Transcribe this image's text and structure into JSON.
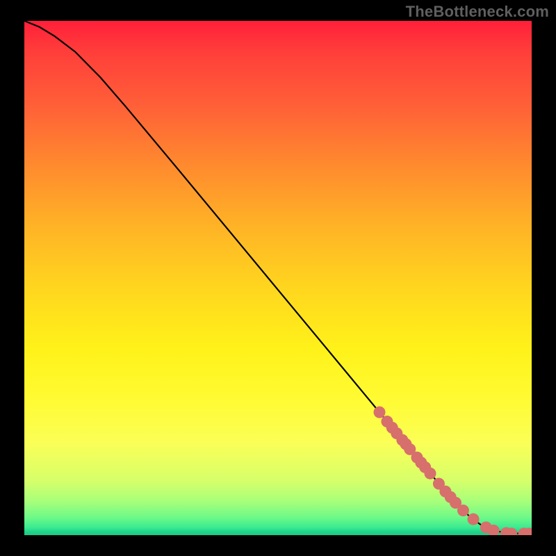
{
  "attribution": "TheBottleneck.com",
  "chart_data": {
    "type": "line",
    "title": "",
    "xlabel": "",
    "ylabel": "",
    "xlim": [
      0,
      100
    ],
    "ylim": [
      0,
      100
    ],
    "series": [
      {
        "name": "curve",
        "x": [
          0,
          3,
          6,
          10,
          15,
          20,
          30,
          40,
          50,
          60,
          70,
          75,
          80,
          85,
          88,
          90,
          92,
          94,
          96,
          98,
          100
        ],
        "y": [
          100,
          98.8,
          97.0,
          94.0,
          89.0,
          83.3,
          71.5,
          59.6,
          47.7,
          35.8,
          23.9,
          17.9,
          12.0,
          6.3,
          3.4,
          2.0,
          1.1,
          0.6,
          0.35,
          0.3,
          0.3
        ]
      }
    ],
    "markers": [
      {
        "x": 70.0,
        "y": 23.9
      },
      {
        "x": 71.5,
        "y": 22.1
      },
      {
        "x": 72.5,
        "y": 20.9
      },
      {
        "x": 73.4,
        "y": 19.8
      },
      {
        "x": 74.5,
        "y": 18.5
      },
      {
        "x": 75.2,
        "y": 17.7
      },
      {
        "x": 76.0,
        "y": 16.7
      },
      {
        "x": 77.4,
        "y": 15.1
      },
      {
        "x": 78.2,
        "y": 14.1
      },
      {
        "x": 79.0,
        "y": 13.2
      },
      {
        "x": 80.0,
        "y": 12.0
      },
      {
        "x": 81.7,
        "y": 10.0
      },
      {
        "x": 83.0,
        "y": 8.5
      },
      {
        "x": 84.0,
        "y": 7.4
      },
      {
        "x": 85.0,
        "y": 6.3
      },
      {
        "x": 86.5,
        "y": 4.8
      },
      {
        "x": 88.5,
        "y": 3.1
      },
      {
        "x": 91.0,
        "y": 1.5
      },
      {
        "x": 92.5,
        "y": 0.9
      },
      {
        "x": 95.0,
        "y": 0.4
      },
      {
        "x": 96.0,
        "y": 0.3
      },
      {
        "x": 98.5,
        "y": 0.3
      },
      {
        "x": 99.5,
        "y": 0.3
      }
    ],
    "marker_color": "#d76f6c",
    "curve_color": "#000000"
  }
}
